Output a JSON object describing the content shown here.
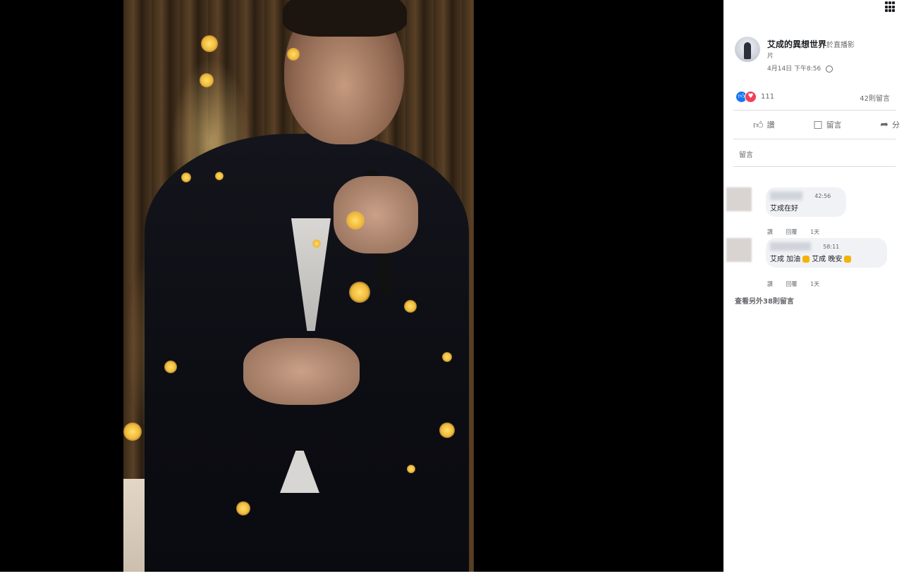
{
  "post": {
    "page_name": "艾成的異想世界",
    "page_name_extra": "於直播影",
    "sub_line": "片",
    "timestamp": "4月14日 下午8:56",
    "reaction_count": "111",
    "comment_count": "42則留言"
  },
  "actions": {
    "like": "讚",
    "comment": "留言",
    "share": "分"
  },
  "comments_section": {
    "sort_label": "留言",
    "items": [
      {
        "stamp": "42:56",
        "text": "艾成在好",
        "like": "讚",
        "reply": "回覆",
        "time": "1天"
      },
      {
        "stamp": "58:11",
        "text_a": "艾成 加油",
        "text_b": "艾成 晚安",
        "like": "讚",
        "reply": "回覆",
        "time": "1天"
      }
    ],
    "more": "查看另外38則留言"
  },
  "icons": {
    "grid": "grid-icon",
    "globe": "globe-icon",
    "like": "thumbs-up-icon",
    "love": "heart-icon",
    "comment": "speech-bubble-icon",
    "share": "share-arrow-icon"
  },
  "colors": {
    "like_blue": "#1877f2",
    "love_red": "#f33e58",
    "viewer_bg": "#000000"
  }
}
